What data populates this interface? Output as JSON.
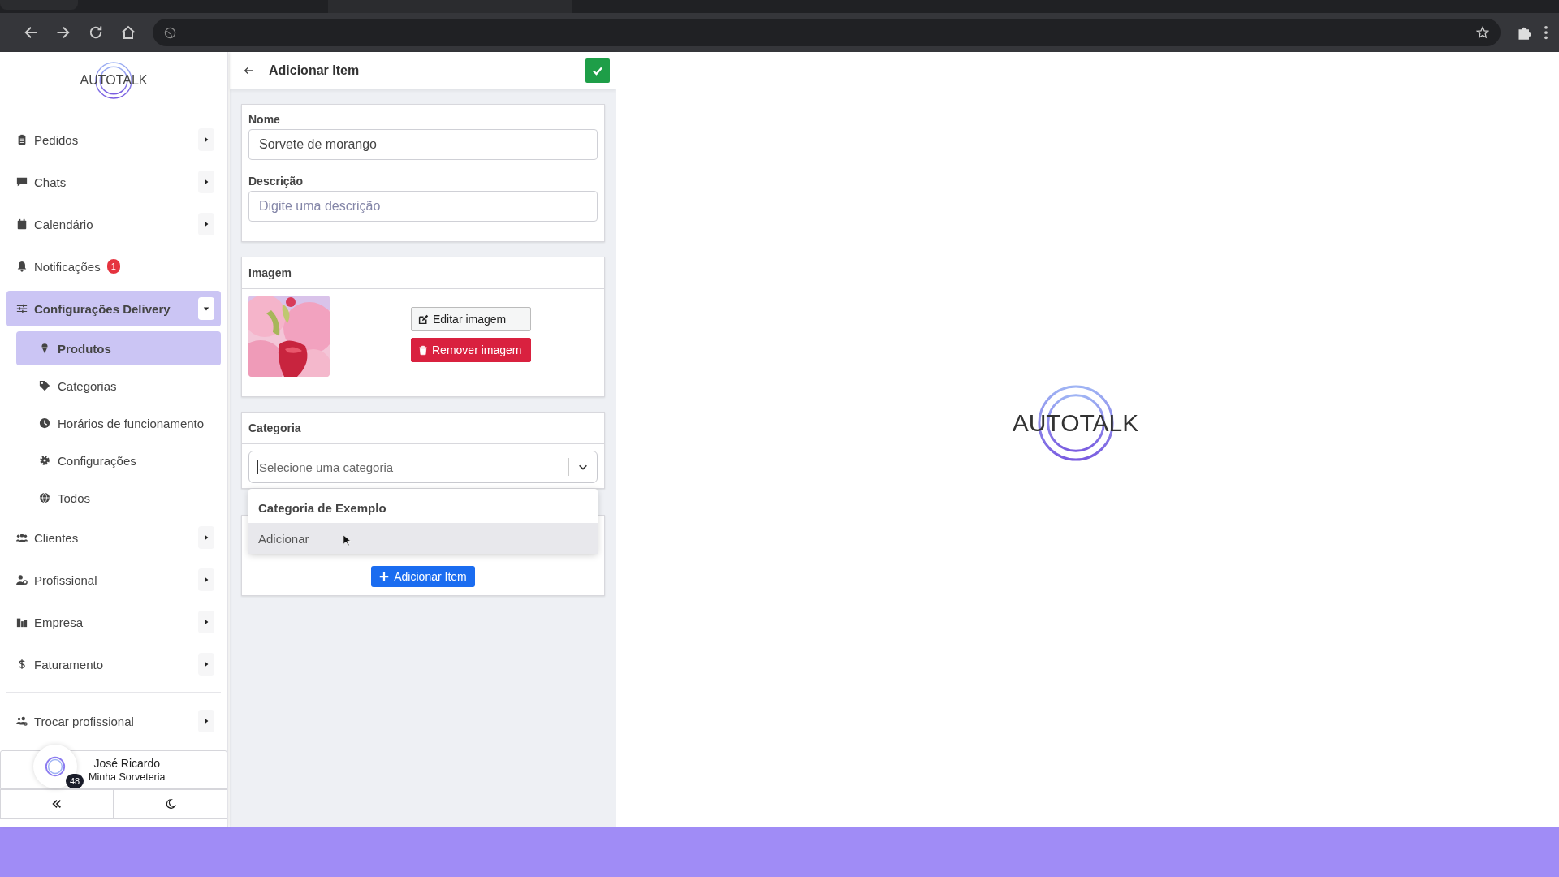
{
  "sidebar": {
    "logo": "AUTOTALK",
    "items": [
      {
        "label": "Pedidos",
        "kind": "submenu",
        "selected": false,
        "expanded": false
      },
      {
        "label": "Chats",
        "kind": "submenu",
        "selected": false,
        "expanded": false
      },
      {
        "label": "Calendário",
        "kind": "submenu",
        "selected": false,
        "expanded": false
      },
      {
        "label": "Notificações",
        "kind": "link",
        "selected": false,
        "badge": "1"
      },
      {
        "label": "Configurações Delivery",
        "kind": "submenu",
        "selected": true,
        "expanded": true,
        "children": [
          {
            "label": "Produtos",
            "selected": true
          },
          {
            "label": "Categorias",
            "selected": false
          },
          {
            "label": "Horários de funcionamento",
            "selected": false
          },
          {
            "label": "Configurações",
            "selected": false
          },
          {
            "label": "Todos",
            "selected": false
          }
        ]
      },
      {
        "label": "Clientes",
        "kind": "submenu",
        "selected": false,
        "expanded": false
      },
      {
        "label": "Profissional",
        "kind": "submenu",
        "selected": false,
        "expanded": false
      },
      {
        "label": "Empresa",
        "kind": "submenu",
        "selected": false,
        "expanded": false
      },
      {
        "label": "Faturamento",
        "kind": "submenu",
        "selected": false,
        "expanded": false
      }
    ],
    "footer_items": [
      {
        "label": "Trocar profissional",
        "kind": "submenu",
        "selected": false,
        "expanded": false
      }
    ],
    "user": {
      "name": "José Ricardo",
      "store": "Minha Sorveteria",
      "count": "48"
    }
  },
  "form": {
    "title": "Adicionar Item",
    "name": {
      "label": "Nome",
      "value": "Sorvete de morango"
    },
    "description": {
      "label": "Descrição",
      "placeholder": "Digite uma descrição"
    },
    "image": {
      "title": "Imagem",
      "kind": "picture",
      "buttons": [
        {
          "label": "Editar imagem",
          "kind": "edit"
        },
        {
          "label": "Remover imagem",
          "kind": "remove"
        }
      ]
    },
    "category": {
      "title": "Categoria",
      "placeholder": "Selecione uma categoria",
      "options": [
        {
          "label": "Categoria de Exemplo",
          "kind": "group",
          "selected": false
        },
        {
          "label": "Adicionar",
          "kind": "option",
          "selected": true
        }
      ]
    },
    "submit": "Adicionar Item"
  },
  "main": {
    "logo": "AUTOTALK"
  }
}
